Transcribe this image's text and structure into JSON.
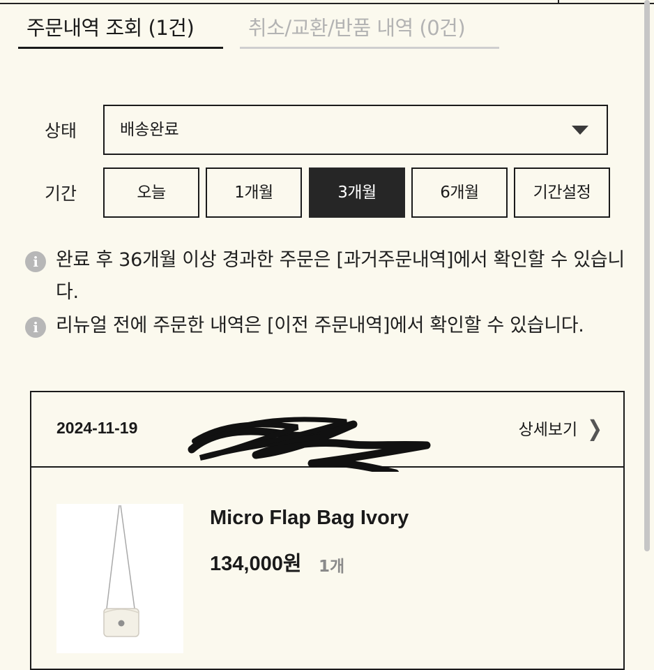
{
  "tabs": {
    "active": "주문내역 조회 (1건)",
    "inactive": "취소/교환/반품 내역 (0건)"
  },
  "filter": {
    "status_label": "상태",
    "status_value": "배송완료",
    "period_label": "기간",
    "period_options": [
      "오늘",
      "1개월",
      "3개월",
      "6개월",
      "기간설정"
    ],
    "period_selected": "3개월"
  },
  "notices": [
    "완료 후 36개월 이상 경과한 주문은 [과거주문내역]에서 확인할 수 있습니다.",
    "리뉴얼 전에 주문한 내역은 [이전 주문내역]에서 확인할 수 있습니다."
  ],
  "order": {
    "date": "2024-11-19",
    "detail_label": "상세보기",
    "product_name": "Micro Flap Bag Ivory",
    "price": "134,000원",
    "quantity": "1개"
  },
  "icons": {
    "info": "info-icon",
    "select_caret": "caret-down-icon",
    "detail": "chevron-right-icon"
  },
  "colors": {
    "background": "#fbf9ee",
    "selected_button": "#262626",
    "inactive_tab": "#b3b3b3"
  }
}
